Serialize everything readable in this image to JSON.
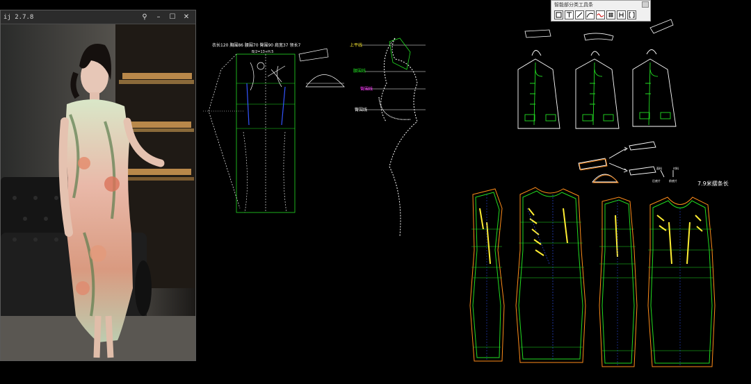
{
  "viewer": {
    "title": "ij 2.7.8",
    "controls": {
      "pin": "⚲",
      "minimize": "–",
      "maximize": "☐",
      "close": "✕"
    }
  },
  "toolbar": {
    "title": "智能部分类工具条",
    "tools": [
      {
        "icon": "rectangle-icon"
      },
      {
        "icon": "t-square-icon"
      },
      {
        "icon": "line-icon"
      },
      {
        "icon": "curve-icon"
      },
      {
        "icon": "wave-icon"
      },
      {
        "icon": "grid-icon"
      },
      {
        "icon": "h-icon"
      },
      {
        "icon": "bracket-icon"
      }
    ]
  },
  "draft_header": {
    "measurements": "衣长120   胸围86   腰围70   臀围90   肩宽37   领长7",
    "formula": "B/2=13+H.5"
  },
  "body_form_labels": {
    "chest_line": "上平线",
    "waist_line": "腰围线",
    "hip_line": "臀围线",
    "knee_line": "臀围线"
  },
  "note": "7.9米摆条长",
  "small_labels": {
    "left_piece": "后底片",
    "right_piece": "前底片",
    "top_right_mark": "面料",
    "top_left_mark": "衬料"
  },
  "colors": {
    "background": "#000000",
    "cad_white": "#ffffff",
    "cad_green": "#22dd22",
    "cad_orange": "#ff8c1a",
    "cad_magenta": "#ff33ff",
    "cad_yellow": "#ffee33",
    "cad_blue": "#3355ff"
  }
}
